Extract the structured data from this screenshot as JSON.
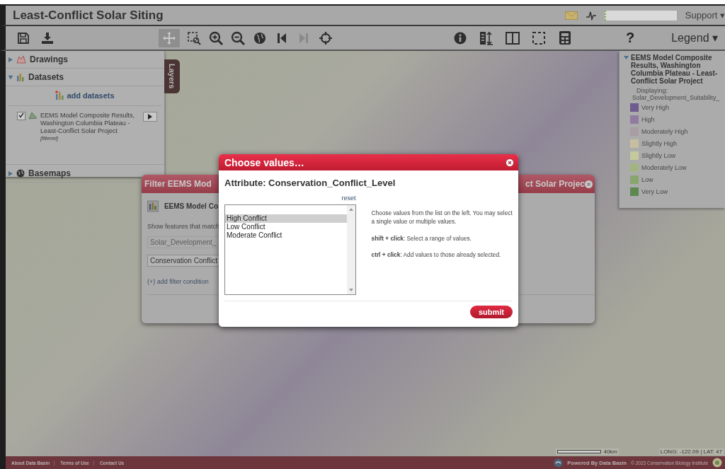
{
  "app_title": "Least-Conflict Solar Siting",
  "header": {
    "support": "Support ▾"
  },
  "toolbar": {
    "tools": [
      {
        "selected": false,
        "disabled": false
      },
      {
        "selected": false,
        "disabled": false
      },
      {
        "selected": true,
        "disabled": false
      },
      {
        "selected": false,
        "disabled": false
      },
      {
        "selected": false,
        "disabled": false
      },
      {
        "selected": false,
        "disabled": false
      },
      {
        "selected": false,
        "disabled": false
      },
      {
        "selected": false,
        "disabled": false
      },
      {
        "selected": false,
        "disabled": true
      },
      {
        "selected": false,
        "disabled": false
      },
      {
        "selected": false,
        "disabled": false
      },
      {
        "selected": false,
        "disabled": false
      },
      {
        "selected": false,
        "disabled": false
      },
      {
        "selected": false,
        "disabled": false
      },
      {
        "selected": false,
        "disabled": false
      }
    ],
    "help": "?",
    "legend_button": "Legend ▾"
  },
  "layers_panel": {
    "tab": "Layers",
    "sections": [
      {
        "label": "Drawings",
        "expanded": false
      },
      {
        "label": "Datasets",
        "expanded": true
      },
      {
        "label": "Basemaps",
        "expanded": false
      }
    ],
    "add_datasets": "add datasets",
    "dataset": {
      "checked": true,
      "name": "EEMS Model Composite Results, Washington Columbia Plateau - Least-Conflict Solar Project",
      "tag": "[filtered]"
    }
  },
  "legend": {
    "title": "EEMS Model Composite Results, Washington Columbia Plateau - Least-Conflict Solar Project",
    "displaying_label": "Displaying:",
    "displaying_value": "Solar_Development_Suitability_",
    "items": [
      {
        "label": "Very High",
        "color": "#6f5b8d"
      },
      {
        "label": "High",
        "color": "#917c9f"
      },
      {
        "label": "Moderately High",
        "color": "#a99ca3"
      },
      {
        "label": "Slightly High",
        "color": "#c6bf9f"
      },
      {
        "label": "Slightly Low",
        "color": "#c5c99b"
      },
      {
        "label": "Moderately Low",
        "color": "#a3b483"
      },
      {
        "label": "Low",
        "color": "#88a56d"
      },
      {
        "label": "Very Low",
        "color": "#5d8850"
      }
    ]
  },
  "filter_dialog": {
    "title_left": "Filter EEMS Mod",
    "title_right": "ct Solar Projec",
    "dataset_name": "EEMS Model Co",
    "instruction": "Show features that match",
    "field_1": "Solar_Development_",
    "field_2": "Conservation Conflict",
    "add_condition": "(+) add filter condition"
  },
  "modal": {
    "title": "Choose values…",
    "attribute": "Attribute: Conservation_Conflict_Level",
    "reset": "reset",
    "values": [
      {
        "label": "High Conflict",
        "selected": true
      },
      {
        "label": "Low Conflict",
        "selected": false
      },
      {
        "label": "Moderate Conflict",
        "selected": false
      }
    ],
    "help": [
      "Choose values from the list on the left. You may select a single value or multiple values.",
      "**shift + click**: Select a range of values.",
      "**ctrl + click**: Add values to those already selected."
    ],
    "submit": "submit"
  },
  "map": {
    "scale": "40km",
    "coordinates": "LONG: -122.09 | LAT: 47"
  },
  "footer": {
    "links": [
      "About Data Basin",
      "Terms of Use",
      "Contact Us"
    ],
    "powered_by": "Powered By Data Basin",
    "copyright": "© 2023 Conservation Biology Institute"
  }
}
